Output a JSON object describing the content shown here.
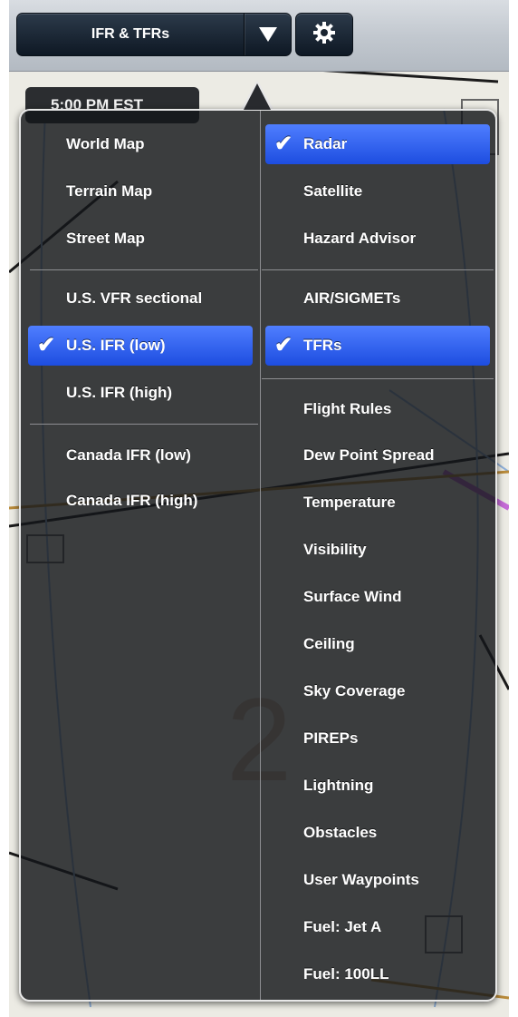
{
  "toolbar": {
    "layer_label": "IFR & TFRs",
    "dropdown_icon": "triangle-down-icon",
    "settings_icon": "gear-icon"
  },
  "map": {
    "time_label": "5:00 PM EST"
  },
  "menu": {
    "base_maps": [
      {
        "label": "World Map",
        "selected": false
      },
      {
        "label": "Terrain Map",
        "selected": false
      },
      {
        "label": "Street Map",
        "selected": false
      }
    ],
    "charts_us": [
      {
        "label": "U.S. VFR sectional",
        "selected": false
      },
      {
        "label": "U.S. IFR (low)",
        "selected": true
      },
      {
        "label": "U.S. IFR (high)",
        "selected": false
      }
    ],
    "charts_canada": [
      {
        "label": "Canada IFR (low)",
        "selected": false
      },
      {
        "label": "Canada IFR (high)",
        "selected": false
      }
    ],
    "weather_imagery": [
      {
        "label": "Radar",
        "selected": true
      },
      {
        "label": "Satellite",
        "selected": false
      },
      {
        "label": "Hazard Advisor",
        "selected": false
      }
    ],
    "advisories": [
      {
        "label": "AIR/SIGMETs",
        "selected": false
      },
      {
        "label": "TFRs",
        "selected": true
      }
    ],
    "overlays": [
      {
        "label": "Flight Rules",
        "selected": false
      },
      {
        "label": "Dew Point Spread",
        "selected": false
      },
      {
        "label": "Temperature",
        "selected": false
      },
      {
        "label": "Visibility",
        "selected": false
      },
      {
        "label": "Surface Wind",
        "selected": false
      },
      {
        "label": "Ceiling",
        "selected": false
      },
      {
        "label": "Sky Coverage",
        "selected": false
      },
      {
        "label": "PIREPs",
        "selected": false
      },
      {
        "label": "Lightning",
        "selected": false
      },
      {
        "label": "Obstacles",
        "selected": false
      },
      {
        "label": "User Waypoints",
        "selected": false
      },
      {
        "label": "Fuel: Jet A",
        "selected": false
      },
      {
        "label": "Fuel: 100LL",
        "selected": false
      }
    ],
    "check_mark": "✔",
    "selection_color": "#2f5ff0"
  }
}
